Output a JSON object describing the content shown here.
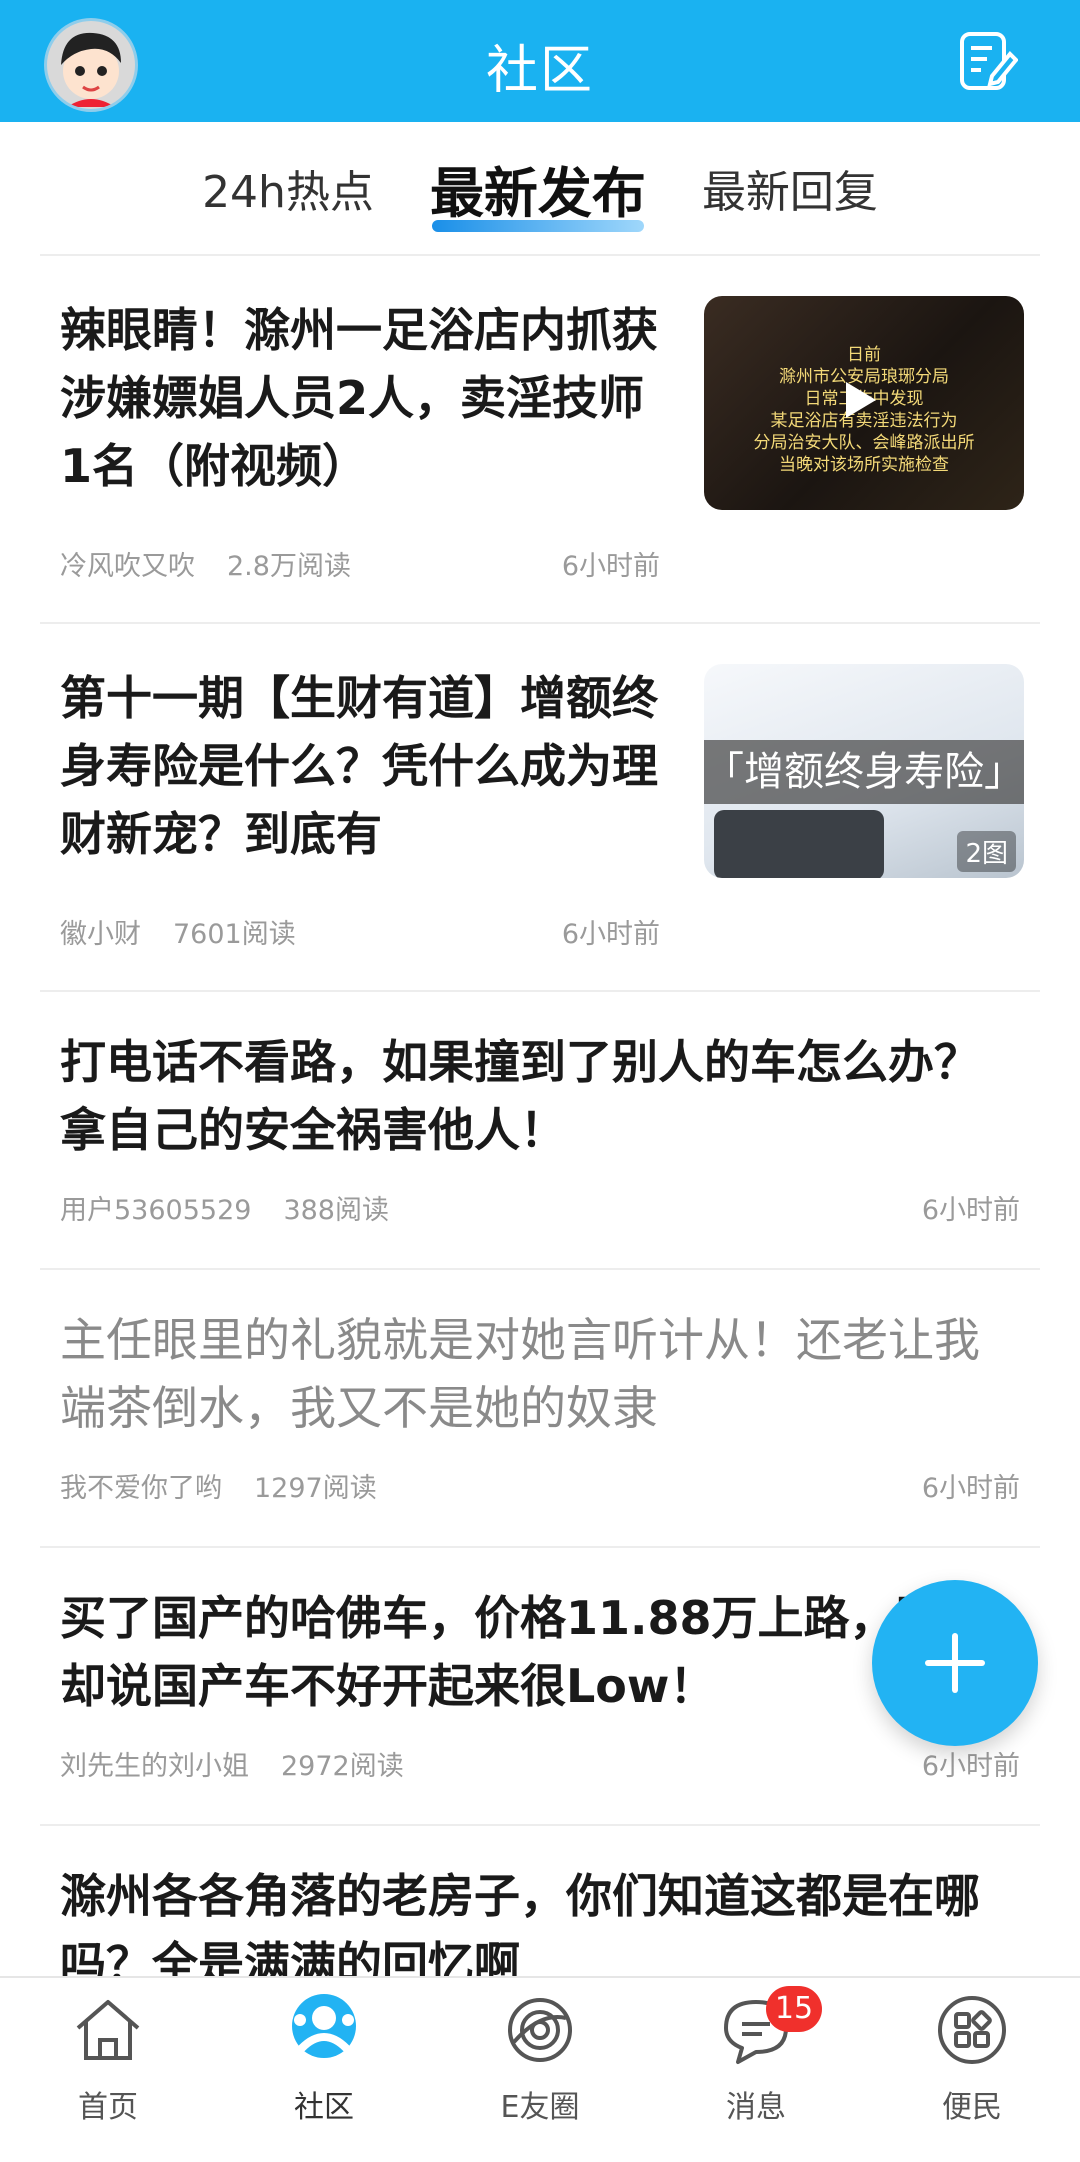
{
  "header": {
    "title": "社区",
    "avatar_icon": "cartoon-avatar",
    "compose_icon": "edit-note-icon"
  },
  "tabs": [
    {
      "label": "24h热点",
      "active": false
    },
    {
      "label": "最新发布",
      "active": true
    },
    {
      "label": "最新回复",
      "active": false
    }
  ],
  "posts": [
    {
      "title": "辣眼睛！滁州一足浴店内抓获涉嫌嫖娼人员2人，卖淫技师1名（附视频）",
      "author": "冷风吹又吹",
      "reads": "2.8万阅读",
      "time": "6小时前",
      "thumb_text": "日前\n滁州市公安局琅琊分局\n日常工作中发现\n某足浴店有卖淫违法行为\n分局治安大队、会峰路派出所\n当晚对该场所实施检查"
    },
    {
      "title": "第十一期【生财有道】增额终身寿险是什么？凭什么成为理财新宠？到底有",
      "author": "徽小财",
      "reads": "7601阅读",
      "time": "6小时前",
      "thumb_text": "「增额终身寿险」",
      "pic_count": "2图"
    },
    {
      "title": "打电话不看路，如果撞到了别人的车怎么办？拿自己的安全祸害他人！",
      "author": "用户53605529",
      "reads": "388阅读",
      "time": "6小时前"
    },
    {
      "title": "主任眼里的礼貌就是对她言听计从！还老让我端茶倒水，我又不是她的奴隶",
      "author": "我不爱你了哟",
      "reads": "1297阅读",
      "time": "6小时前"
    },
    {
      "title": "买了国产的哈佛车，价格11.88万上路，同事却说国产车不好开起来很Low！",
      "author": "刘先生的刘小姐",
      "reads": "2972阅读",
      "time": "6小时前"
    },
    {
      "title": "滁州各各角落的老房子，你们知道这都是在哪吗？全是满满的回忆啊"
    }
  ],
  "nav": [
    {
      "label": "首页",
      "icon": "home-icon"
    },
    {
      "label": "社区",
      "icon": "community-icon",
      "active": true
    },
    {
      "label": "E友圈",
      "icon": "circle-icon"
    },
    {
      "label": "消息",
      "icon": "message-icon",
      "badge": "15"
    },
    {
      "label": "便民",
      "icon": "grid-icon"
    }
  ],
  "colors": {
    "primary": "#1ab2f1",
    "badge": "#f0302c"
  }
}
